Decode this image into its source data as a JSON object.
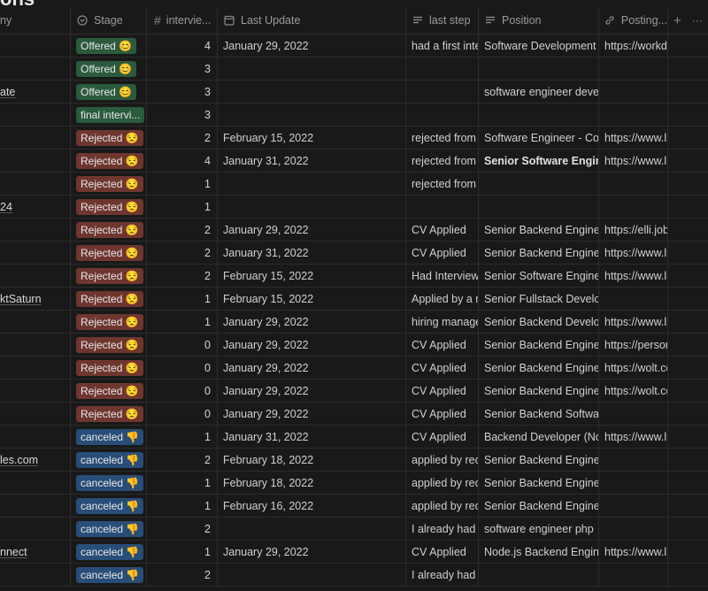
{
  "title_fragment": "ons",
  "headers": {
    "company": "ny",
    "stage": "Stage",
    "interviews": "intervie...",
    "last_update": "Last Update",
    "last_step": "last step",
    "position": "Position",
    "posting": "Posting...",
    "add": "+",
    "more": "···"
  },
  "rows": [
    {
      "company": "",
      "stage": "Offered 😊",
      "stage_type": "offered",
      "interviews": "4",
      "last_update": "January 29, 2022",
      "last_step": "had a first interview",
      "position": "Software Development Engineer",
      "posting": "https://workday",
      "bold": false
    },
    {
      "company": "",
      "stage": "Offered 😊",
      "stage_type": "offered",
      "interviews": "3",
      "last_update": "",
      "last_step": "",
      "position": "",
      "posting": "",
      "bold": false
    },
    {
      "company": "ate",
      "stage": "Offered 😊",
      "stage_type": "offered",
      "interviews": "3",
      "last_update": "",
      "last_step": "",
      "position": "software engineer developer",
      "posting": "",
      "bold": false
    },
    {
      "company": "",
      "stage": "final intervi...",
      "stage_type": "final",
      "interviews": "3",
      "last_update": "",
      "last_step": "",
      "position": "",
      "posting": "",
      "bold": false
    },
    {
      "company": "",
      "stage": "Rejected 😒",
      "stage_type": "rejected",
      "interviews": "2",
      "last_update": "February 15, 2022",
      "last_step": "rejected from the",
      "position": "Software Engineer - Content",
      "posting": "https://www.linkedin",
      "bold": false
    },
    {
      "company": "",
      "stage": "Rejected 😒",
      "stage_type": "rejected",
      "interviews": "4",
      "last_update": "January 31, 2022",
      "last_step": "rejected from the",
      "position": "Senior Software Engineer",
      "posting": "https://www.linkedin",
      "bold": true
    },
    {
      "company": "",
      "stage": "Rejected 😒",
      "stage_type": "rejected",
      "interviews": "1",
      "last_update": "",
      "last_step": "rejected from the",
      "position": "",
      "posting": "",
      "bold": false
    },
    {
      "company": "24",
      "stage": "Rejected 😒",
      "stage_type": "rejected",
      "interviews": "1",
      "last_update": "",
      "last_step": "",
      "position": "",
      "posting": "",
      "bold": false
    },
    {
      "company": "",
      "stage": "Rejected 😒",
      "stage_type": "rejected",
      "interviews": "2",
      "last_update": "January 29, 2022",
      "last_step": "CV Applied",
      "position": "Senior Backend Engineer",
      "posting": "https://elli.jobs",
      "bold": false
    },
    {
      "company": "",
      "stage": "Rejected 😒",
      "stage_type": "rejected",
      "interviews": "2",
      "last_update": "January 31, 2022",
      "last_step": "CV Applied",
      "position": "Senior Backend Engineer",
      "posting": "https://www.linkedin",
      "bold": false
    },
    {
      "company": "",
      "stage": "Rejected 😒",
      "stage_type": "rejected",
      "interviews": "2",
      "last_update": "February 15, 2022",
      "last_step": "Had Interview with",
      "position": "Senior Software Engineer",
      "posting": "https://www.linkedin",
      "bold": false
    },
    {
      "company": "ktSaturn",
      "stage": "Rejected 😒",
      "stage_type": "rejected",
      "interviews": "1",
      "last_update": "February 15, 2022",
      "last_step": "Applied by a recruiter",
      "position": "Senior Fullstack Developer",
      "posting": "",
      "bold": false
    },
    {
      "company": "",
      "stage": "Rejected 😒",
      "stage_type": "rejected",
      "interviews": "1",
      "last_update": "January 29, 2022",
      "last_step": "hiring manager",
      "position": "Senior Backend Developer",
      "posting": "https://www.linkedin",
      "bold": false
    },
    {
      "company": "",
      "stage": "Rejected 😒",
      "stage_type": "rejected",
      "interviews": "0",
      "last_update": "January 29, 2022",
      "last_step": "CV Applied",
      "position": "Senior Backend Engineer",
      "posting": "https://personio",
      "bold": false
    },
    {
      "company": "",
      "stage": "Rejected 😒",
      "stage_type": "rejected",
      "interviews": "0",
      "last_update": "January 29, 2022",
      "last_step": "CV Applied",
      "position": "Senior Backend Engineer,",
      "posting": "https://wolt.com",
      "bold": false
    },
    {
      "company": "",
      "stage": "Rejected 😒",
      "stage_type": "rejected",
      "interviews": "0",
      "last_update": "January 29, 2022",
      "last_step": "CV Applied",
      "position": "Senior Backend Engineer,",
      "posting": "https://wolt.com",
      "bold": false
    },
    {
      "company": "",
      "stage": "Rejected 😒",
      "stage_type": "rejected",
      "interviews": "0",
      "last_update": "January 29, 2022",
      "last_step": "CV Applied",
      "position": "Senior Backend Software",
      "posting": "",
      "bold": false
    },
    {
      "company": "",
      "stage": "canceled 👎",
      "stage_type": "canceled",
      "interviews": "1",
      "last_update": "January 31, 2022",
      "last_step": "CV Applied",
      "position": "Backend Developer (Node.js)",
      "posting": "https://www.linkedin",
      "bold": false
    },
    {
      "company": "les.com",
      "stage": "canceled 👎",
      "stage_type": "canceled",
      "interviews": "2",
      "last_update": "February 18, 2022",
      "last_step": "applied by recruiter",
      "position": "Senior Backend Engineer",
      "posting": "",
      "bold": false
    },
    {
      "company": "",
      "stage": "canceled 👎",
      "stage_type": "canceled",
      "interviews": "1",
      "last_update": "February 18, 2022",
      "last_step": "applied by recruiter",
      "position": "Senior Backend Engineer",
      "posting": "",
      "bold": false
    },
    {
      "company": "",
      "stage": "canceled 👎",
      "stage_type": "canceled",
      "interviews": "1",
      "last_update": "February 16, 2022",
      "last_step": "applied by recruiter",
      "position": "Senior Backend Engineer",
      "posting": "",
      "bold": false
    },
    {
      "company": "",
      "stage": "canceled 👎",
      "stage_type": "canceled",
      "interviews": "2",
      "last_update": "",
      "last_step": "I already had some",
      "position": "software engineer php",
      "posting": "",
      "bold": false
    },
    {
      "company": "nnect",
      "stage": "canceled 👎",
      "stage_type": "canceled",
      "interviews": "1",
      "last_update": "January 29, 2022",
      "last_step": "CV Applied",
      "position": "Node.js Backend Engineer",
      "posting": "https://www.linkedin",
      "bold": false
    },
    {
      "company": "",
      "stage": "canceled 👎",
      "stage_type": "canceled",
      "interviews": "2",
      "last_update": "",
      "last_step": "I already had some",
      "position": "",
      "posting": "",
      "bold": false
    }
  ]
}
